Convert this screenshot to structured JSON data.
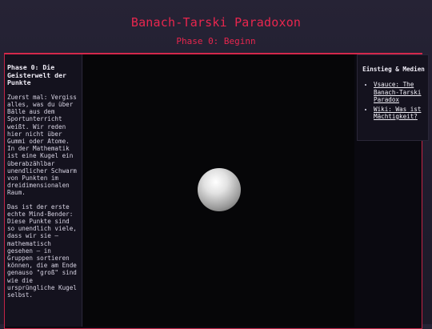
{
  "header": {
    "title": "Banach-Tarski Paradoxon",
    "phase": "Phase 0: Beginn"
  },
  "left_panel": {
    "heading": "Phase 0: Die Geisterwelt der Punkte",
    "paragraphs": [
      "Zuerst mal: Vergiss alles, was du über Bälle aus dem Sportunterricht weißt. Wir reden hier nicht über Gummi oder Atome. In der Mathematik ist eine Kugel ein überabzählbar unendlicher Schwarm von Punkten im dreidimensionalen Raum.",
      "Das ist der erste echte Mind-Bender: Diese Punkte sind so unendlich viele, dass wir sie – mathematisch gesehen – in Gruppen sortieren können, die am Ende genauso \"groß\" sind wie die ursprüngliche Kugel selbst."
    ]
  },
  "right_panel": {
    "heading": "Einstieg & Medien",
    "links": [
      "Vsauce: The Banach-Tarski Paradox",
      "Wiki: Was ist Mächtigkeit?"
    ]
  },
  "stage": {
    "object": "sphere",
    "background_color": "#060608"
  },
  "colors": {
    "accent": "#e8264e",
    "panel": "#14121e",
    "background": "#231f31"
  }
}
